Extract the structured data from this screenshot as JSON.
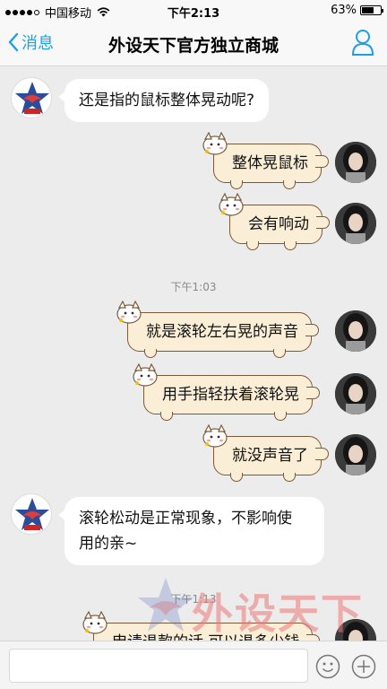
{
  "status_bar": {
    "carrier": "中国移动",
    "time": "下午2:13",
    "battery": "63%",
    "battery_level": 0.63,
    "signal_dots": 4
  },
  "nav": {
    "back_label": "消息",
    "title": "外设天下官方独立商城",
    "profile_icon": "person-icon"
  },
  "messages": [
    {
      "side": "in",
      "text": "还是指的鼠标整体晃动呢?"
    },
    {
      "side": "out",
      "text": "整体晃鼠标"
    },
    {
      "side": "out",
      "text": "会有响动"
    },
    {
      "side": "time",
      "text": "下午1:03"
    },
    {
      "side": "out",
      "text": "就是滚轮左右晃的声音"
    },
    {
      "side": "out",
      "text": "用手指轻扶着滚轮晃"
    },
    {
      "side": "out",
      "text": "就没声音了"
    },
    {
      "side": "in",
      "text_line1": "滚轮松动是正常现象，不影响使",
      "text_line2": "用的亲~"
    },
    {
      "side": "time",
      "text": "下午1:13"
    },
    {
      "side": "out",
      "text": "申请退款的话 可以退多少钱"
    }
  ],
  "watermark": {
    "text": "外设天下",
    "url": "www.wstx.com"
  },
  "input_bar": {
    "value": "",
    "emoji_icon": "smiley-icon",
    "plus_icon": "plus-icon"
  },
  "colors": {
    "accent": "#1aa1e6",
    "outgoing_bubble": "#fbeed6",
    "bubble_border": "#7a5a3a"
  }
}
